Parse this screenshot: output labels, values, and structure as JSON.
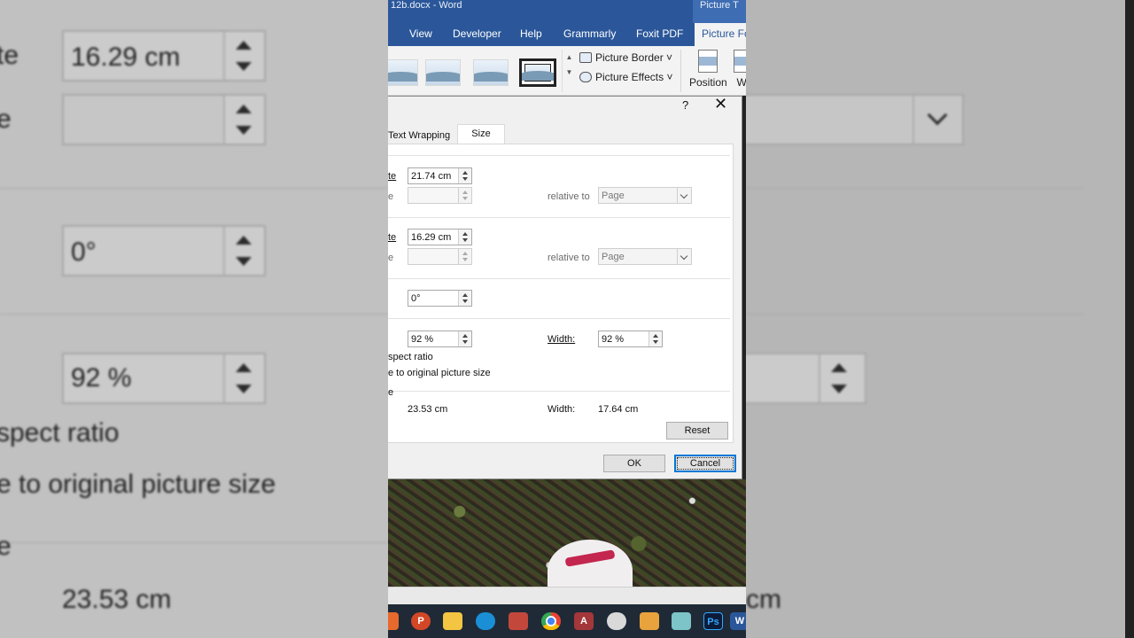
{
  "ribbon": {
    "title": "12b.docx  -  Word",
    "context_tab": "Picture T",
    "tabs": [
      "View",
      "Developer",
      "Help",
      "Grammarly",
      "Foxit PDF",
      "Picture Fo"
    ],
    "commands": {
      "border": "Picture Border ˅",
      "effects": "Picture Effects ˅"
    },
    "big_buttons": [
      "Position",
      "Wr"
    ]
  },
  "dialog": {
    "help": "?",
    "close": "✕",
    "tabs": [
      "Text Wrapping",
      "Size"
    ],
    "height_absolute_label": "te",
    "height_absolute_value": "21.74 cm",
    "height_relative_label": "e",
    "height_relative_to_label": "relative to",
    "height_relative_to_value": "Page",
    "width_absolute_label": "te",
    "width_absolute_value": "16.29 cm",
    "width_relative_label": "e",
    "width_relative_to_label": "relative to",
    "width_relative_to_value": "Page",
    "rotation_value": "0°",
    "scale_height_value": "92 %",
    "scale_width_label": "Width:",
    "scale_width_value": "92 %",
    "lock_aspect_label": "spect ratio",
    "relative_original_label": "e to original picture size",
    "original_size_label": "e",
    "original_height_value": "23.53 cm",
    "original_width_label": "Width:",
    "original_width_value": "17.64 cm",
    "reset_label": "Reset",
    "ok_label": "OK",
    "cancel_label": "Cancel"
  },
  "background_zoom": {
    "left": {
      "absolute_label": "te",
      "absolute_value": "16.29 cm",
      "relative_label": "e",
      "rotation_value": "0°",
      "scale_value": "92 %",
      "lock_aspect": "spect ratio",
      "relative_original": "e to original picture size",
      "original_size": "e",
      "original_value": "23.53 cm"
    },
    "right": {
      "value": "cm"
    }
  },
  "taskbar": {
    "icons": [
      "file-explorer-icon",
      "powerpoint-icon",
      "folder-icon",
      "edge-icon",
      "paint-icon",
      "chrome-icon",
      "access-icon",
      "onedrive-icon",
      "media-icon",
      "app-icon",
      "photoshop-icon",
      "word-icon"
    ],
    "photoshop_label": "Ps",
    "word_label": "W",
    "access_label": "A",
    "powerpoint_label": "P"
  }
}
